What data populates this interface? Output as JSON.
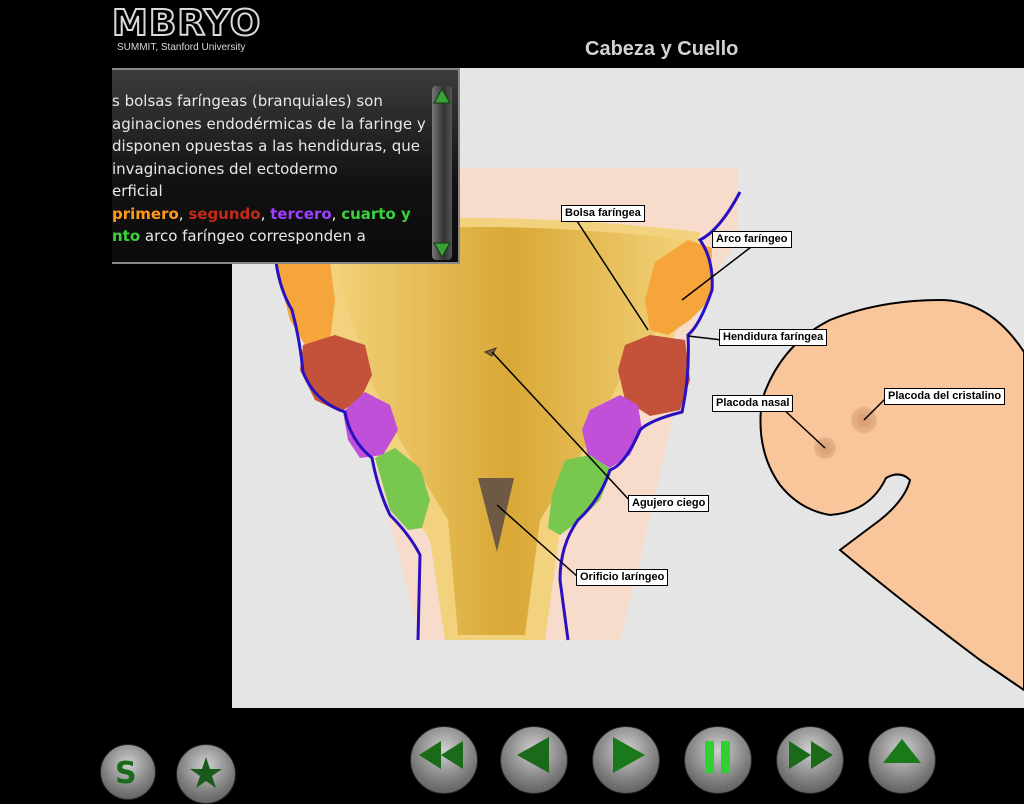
{
  "header": {
    "logo_text": "MBRYO",
    "logo_subtitle": "SUMMIT, Stanford University",
    "title": "Cabeza y Cuello"
  },
  "text_panel": {
    "line1": "s bolsas faríngeas (branquiales) son",
    "line2": "aginaciones endodérmicas de la faringe y",
    "line3": "disponen opuestas a las hendiduras, que",
    "line4": " invaginaciones del ectodermo",
    "line5": "erficial",
    "line6_primero": "primero",
    "line6_sep1": ", ",
    "line6_segundo": "segundo",
    "line6_sep2": ", ",
    "line6_tercero": "tercero",
    "line6_sep3": ", ",
    "line6_cuarto": "cuarto y",
    "line7_quinto": "nto",
    "line7_rest": " arco faríngeo corresponden a",
    "colors": {
      "primero": "#ff9a1a",
      "segundo": "#c42a1a",
      "tercero": "#a040ff",
      "cuarto": "#3ad23a",
      "quinto": "#3ad23a"
    }
  },
  "labels": {
    "bolsa": "Bolsa faríngea",
    "arco": "Arco faríngeo",
    "hendidura": "Hendidura faríngea",
    "placoda_nasal": "Placoda nasal",
    "placoda_cristalino": "Placoda del cristalino",
    "agujero": "Agujero ciego",
    "orificio": "Orificio laríngeo"
  },
  "controls": {
    "items": [
      "rewind-icon",
      "previous-icon",
      "play-icon",
      "pause-icon",
      "fast-forward-icon",
      "eject-icon"
    ]
  },
  "colors": {
    "arch1": "#f5a53a",
    "arch2": "#c4523a",
    "arch3": "#c050d8",
    "arch4": "#78c850",
    "pharynx": "#dfb240",
    "ectoderm_line": "#2a10c0",
    "face": "#f9c59a"
  }
}
